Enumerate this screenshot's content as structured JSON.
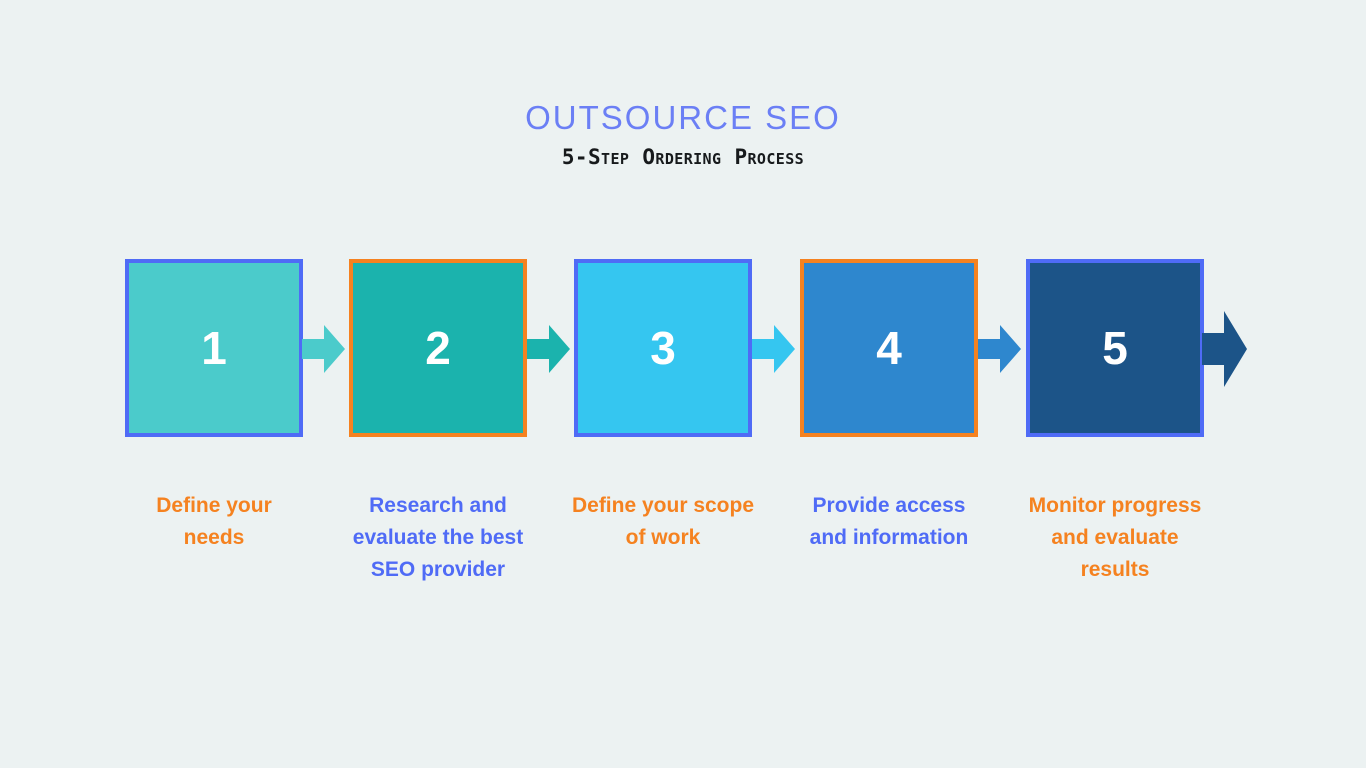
{
  "page": {
    "background_color": "#ecf2f2",
    "title": "OUTSOURCE SEO",
    "subtitle": "5-Step Ordering Process",
    "title_color": "#6b7ff5",
    "subtitle_color": "#171a1c"
  },
  "palette": {
    "orange": "#f58220",
    "blue": "#4f6bf6",
    "white": "#ffffff"
  },
  "steps": [
    {
      "number": "1",
      "caption": "Define your needs",
      "fill_color": "#4bcbcb",
      "border_color": "#4f6bf6",
      "caption_color": "#f58220",
      "arrow_color": "#4bcbcb"
    },
    {
      "number": "2",
      "caption": "Research and evaluate the best SEO provider",
      "fill_color": "#1bb3ad",
      "border_color": "#f58220",
      "caption_color": "#4f6bf6",
      "arrow_color": "#1bb3ad"
    },
    {
      "number": "3",
      "caption": "Define your scope of work",
      "fill_color": "#35c6f0",
      "border_color": "#4f6bf6",
      "caption_color": "#f58220",
      "arrow_color": "#35c6f0"
    },
    {
      "number": "4",
      "caption": "Provide access and information",
      "fill_color": "#2e87ce",
      "border_color": "#f58220",
      "caption_color": "#4f6bf6",
      "arrow_color": "#2e87ce"
    },
    {
      "number": "5",
      "caption": "Monitor progress and evaluate results",
      "fill_color": "#1c5488",
      "border_color": "#4f6bf6",
      "caption_color": "#f58220",
      "arrow_color": "#1c5488"
    }
  ]
}
